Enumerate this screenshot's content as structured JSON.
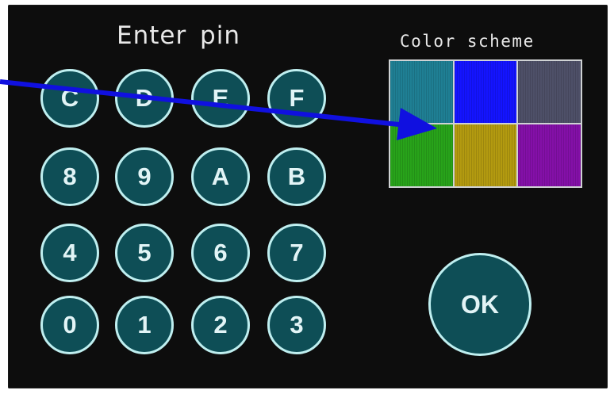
{
  "keypad": {
    "title": "Enter pin",
    "keys": [
      [
        "C",
        "D",
        "E",
        "F"
      ],
      [
        "8",
        "9",
        "A",
        "B"
      ],
      [
        "4",
        "5",
        "6",
        "7"
      ],
      [
        "0",
        "1",
        "2",
        "3"
      ]
    ],
    "ok_label": "OK"
  },
  "color_scheme": {
    "title": "Color scheme",
    "swatches": [
      "#1f7f94",
      "#1414ff",
      "#4e5068",
      "#28a31a",
      "#b39a10",
      "#8410a8"
    ]
  },
  "colors": {
    "screen_background": "#0d0d0d",
    "key_fill": "#0e4e56",
    "key_outline": "#bfeff0",
    "annotation_arrow": "#1010e0"
  }
}
